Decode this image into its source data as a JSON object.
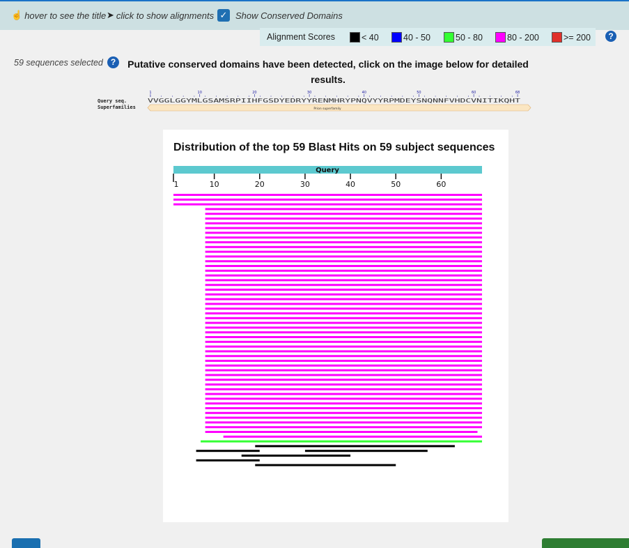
{
  "toolbar": {
    "hover_hint": "hover to see the title",
    "click_hint": "click to show alignments",
    "show_cdd_label": "Show Conserved Domains",
    "show_cdd_checked": true
  },
  "legend": {
    "title": "Alignment Scores",
    "items": [
      {
        "label": "< 40",
        "color": "#000000"
      },
      {
        "label": "40 - 50",
        "color": "#0000ff"
      },
      {
        "label": "50 - 80",
        "color": "#33ff33"
      },
      {
        "label": "80 - 200",
        "color": "#ff00ff"
      },
      {
        "label": ">= 200",
        "color": "#e0302a"
      }
    ]
  },
  "summary": {
    "selected_text": "59 sequences selected",
    "message": "Putative conserved domains have been detected, click on the image below for detailed results."
  },
  "cdd": {
    "query_label": "Query seq.",
    "superfamilies_label": "Superfamilies",
    "sequence": "VVGGLGGYMLGSAMSRPIIHFGSDYEDRYYRENMHRYPNQVYYRPMDEYSNQNNFVHDCVNITIKQHT",
    "ruler_numbers": [
      "1",
      "10",
      "20",
      "30",
      "40",
      "50",
      "60",
      "68"
    ],
    "domain_label": "Prion superfamily"
  },
  "graphic": {
    "title": "Distribution of the top 59 Blast Hits on 59 subject sequences",
    "query_label": "Query",
    "ticks": [
      "1",
      "10",
      "20",
      "30",
      "40",
      "50",
      "60"
    ],
    "query_length": 68
  },
  "chart_data": {
    "type": "bar",
    "title": "Distribution of the top 59 Blast Hits on 59 subject sequences",
    "xlabel": "",
    "ylabel": "",
    "xlim": [
      1,
      69
    ],
    "ticks": [
      1,
      10,
      20,
      30,
      40,
      50,
      60
    ],
    "hits": [
      {
        "start": 1,
        "end": 69,
        "score": "80 - 200"
      },
      {
        "start": 1,
        "end": 69,
        "score": "80 - 200"
      },
      {
        "start": 1,
        "end": 69,
        "score": "80 - 200"
      },
      {
        "start": 8,
        "end": 69,
        "score": "80 - 200"
      },
      {
        "start": 8,
        "end": 69,
        "score": "80 - 200"
      },
      {
        "start": 8,
        "end": 69,
        "score": "80 - 200"
      },
      {
        "start": 8,
        "end": 69,
        "score": "80 - 200"
      },
      {
        "start": 8,
        "end": 69,
        "score": "80 - 200"
      },
      {
        "start": 8,
        "end": 69,
        "score": "80 - 200"
      },
      {
        "start": 8,
        "end": 69,
        "score": "80 - 200"
      },
      {
        "start": 8,
        "end": 69,
        "score": "80 - 200"
      },
      {
        "start": 8,
        "end": 69,
        "score": "80 - 200"
      },
      {
        "start": 8,
        "end": 69,
        "score": "80 - 200"
      },
      {
        "start": 8,
        "end": 69,
        "score": "80 - 200"
      },
      {
        "start": 8,
        "end": 69,
        "score": "80 - 200"
      },
      {
        "start": 8,
        "end": 69,
        "score": "80 - 200"
      },
      {
        "start": 8,
        "end": 69,
        "score": "80 - 200"
      },
      {
        "start": 8,
        "end": 69,
        "score": "80 - 200"
      },
      {
        "start": 8,
        "end": 69,
        "score": "80 - 200"
      },
      {
        "start": 8,
        "end": 69,
        "score": "80 - 200"
      },
      {
        "start": 8,
        "end": 69,
        "score": "80 - 200"
      },
      {
        "start": 8,
        "end": 69,
        "score": "80 - 200"
      },
      {
        "start": 8,
        "end": 69,
        "score": "80 - 200"
      },
      {
        "start": 8,
        "end": 69,
        "score": "80 - 200"
      },
      {
        "start": 8,
        "end": 69,
        "score": "80 - 200"
      },
      {
        "start": 8,
        "end": 69,
        "score": "80 - 200"
      },
      {
        "start": 8,
        "end": 69,
        "score": "80 - 200"
      },
      {
        "start": 8,
        "end": 69,
        "score": "80 - 200"
      },
      {
        "start": 8,
        "end": 69,
        "score": "80 - 200"
      },
      {
        "start": 8,
        "end": 69,
        "score": "80 - 200"
      },
      {
        "start": 8,
        "end": 69,
        "score": "80 - 200"
      },
      {
        "start": 8,
        "end": 69,
        "score": "80 - 200"
      },
      {
        "start": 8,
        "end": 69,
        "score": "80 - 200"
      },
      {
        "start": 8,
        "end": 69,
        "score": "80 - 200"
      },
      {
        "start": 8,
        "end": 69,
        "score": "80 - 200"
      },
      {
        "start": 8,
        "end": 69,
        "score": "80 - 200"
      },
      {
        "start": 8,
        "end": 69,
        "score": "80 - 200"
      },
      {
        "start": 8,
        "end": 69,
        "score": "80 - 200"
      },
      {
        "start": 8,
        "end": 69,
        "score": "80 - 200"
      },
      {
        "start": 8,
        "end": 69,
        "score": "80 - 200"
      },
      {
        "start": 8,
        "end": 69,
        "score": "80 - 200"
      },
      {
        "start": 8,
        "end": 69,
        "score": "80 - 200"
      },
      {
        "start": 8,
        "end": 69,
        "score": "80 - 200"
      },
      {
        "start": 8,
        "end": 69,
        "score": "80 - 200"
      },
      {
        "start": 8,
        "end": 69,
        "score": "80 - 200"
      },
      {
        "start": 8,
        "end": 69,
        "score": "80 - 200"
      },
      {
        "start": 8,
        "end": 69,
        "score": "80 - 200"
      },
      {
        "start": 8,
        "end": 69,
        "score": "80 - 200"
      },
      {
        "start": 8,
        "end": 69,
        "score": "80 - 200"
      },
      {
        "start": 8,
        "end": 69,
        "score": "80 - 200"
      },
      {
        "start": 8,
        "end": 68,
        "score": "80 - 200"
      },
      {
        "start": 12,
        "end": 69,
        "score": "80 - 200"
      },
      {
        "start": 7,
        "end": 69,
        "score": "50 - 80"
      },
      {
        "start": 19,
        "end": 63,
        "score": "< 40"
      },
      {
        "start": 6,
        "end": 20,
        "score": "< 40"
      },
      {
        "start": 30,
        "end": 57,
        "score": "< 40"
      },
      {
        "start": 16,
        "end": 40,
        "score": "< 40"
      },
      {
        "start": 6,
        "end": 20,
        "score": "< 40"
      },
      {
        "start": 19,
        "end": 50,
        "score": "< 40"
      }
    ]
  }
}
